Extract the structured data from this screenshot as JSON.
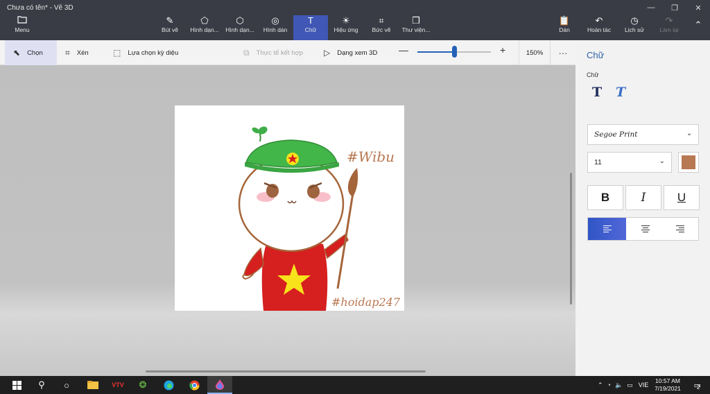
{
  "window": {
    "title": "Chưa có tên* - Vẽ 3D",
    "controls": [
      "—",
      "❐",
      "✕"
    ]
  },
  "ribbon": {
    "menu_label": "Menu",
    "tabs": [
      {
        "label": "Bút vẽ",
        "icon": "brush-icon"
      },
      {
        "label": "Hình dạn...",
        "icon": "2d-shapes-icon"
      },
      {
        "label": "Hình dạn...",
        "icon": "3d-shapes-icon"
      },
      {
        "label": "Hình dán",
        "icon": "stickers-icon"
      },
      {
        "label": "Chữ",
        "icon": "text-icon",
        "active": true
      },
      {
        "label": "Hiệu ứng",
        "icon": "effects-icon"
      },
      {
        "label": "Bức vẽ",
        "icon": "canvas-icon"
      },
      {
        "label": "Thư viện...",
        "icon": "library-icon"
      }
    ],
    "right": [
      {
        "label": "Dán",
        "icon": "paste-icon"
      },
      {
        "label": "Hoàn tác",
        "icon": "undo-icon"
      },
      {
        "label": "Lịch sử",
        "icon": "history-icon"
      },
      {
        "label": "Làm lại",
        "icon": "redo-icon",
        "disabled": true
      }
    ]
  },
  "toolbar": {
    "select": "Chọn",
    "crop": "Xén",
    "magic_select": "Lựa chọn kỳ diệu",
    "mixed_reality": "Thực tế kết hợp",
    "view_3d": "Dạng xem 3D",
    "zoom_minus": "—",
    "zoom_plus": "+",
    "zoom_value": "150%",
    "zoom_fraction": 0.5,
    "more": "···"
  },
  "canvas": {
    "text_wibu": "#Wibu",
    "text_watermark": "#hoidap247"
  },
  "panel": {
    "title": "Chữ",
    "sublabel": "Chữ",
    "text_2d_icon": "T",
    "text_3d_icon": "T",
    "font": "Segoe Print",
    "size": "11",
    "color": "#b87852",
    "bold": "B",
    "italic": "I",
    "underline": "U",
    "align": "left"
  },
  "taskbar": {
    "lang": "VIE",
    "time": "10:57 AM",
    "date": "7/19/2021",
    "notifications": "2"
  }
}
